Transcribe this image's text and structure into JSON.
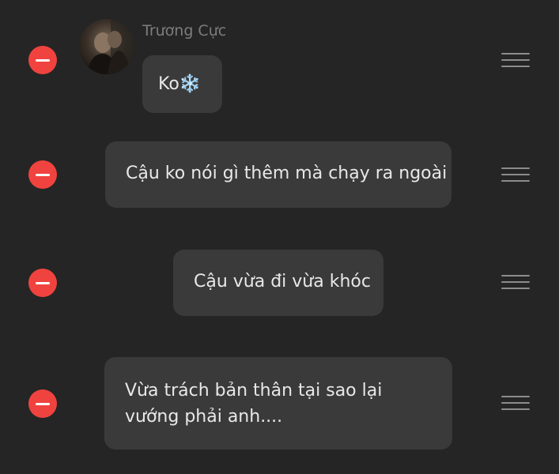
{
  "sender": {
    "name": "Trương Cực"
  },
  "messages": [
    {
      "text": "Ko",
      "emoji": "❄️"
    },
    {
      "text": "Cậu ko nói gì thêm mà chạy ra ngoài"
    },
    {
      "text": "Cậu vừa đi vừa khóc"
    },
    {
      "text": "Vừa trách bản thân tại sao lại vướng phải anh...."
    }
  ],
  "colors": {
    "background": "#252525",
    "bubble": "#3a3a3a",
    "bubble_text": "#e8e8e8",
    "sender_text": "#7d7d7d",
    "delete": "#f0433f",
    "handle": "#8c8c8c"
  },
  "icons": {
    "delete": "minus-circle-icon",
    "reorder": "drag-handle-icon",
    "avatar": "avatar-photo"
  }
}
